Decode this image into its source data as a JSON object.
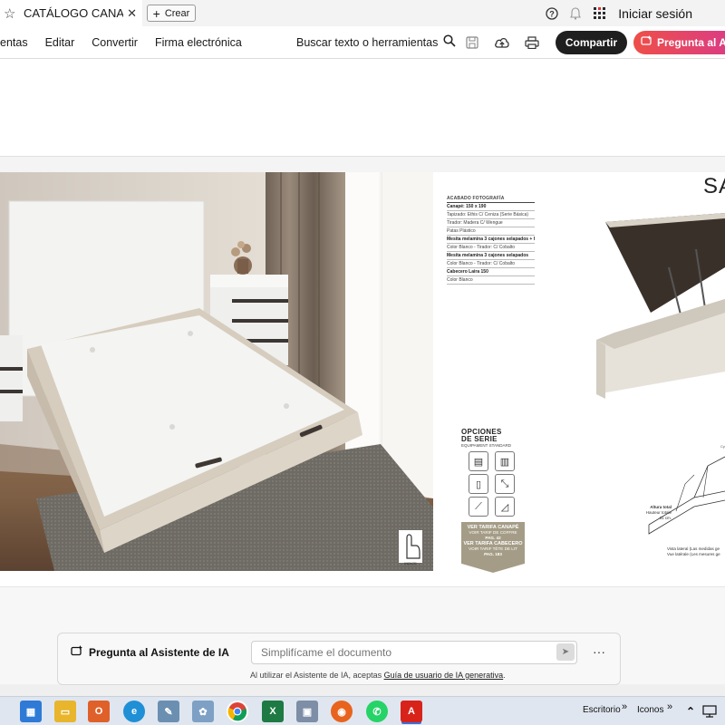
{
  "tab": {
    "title": "CATÁLOGO CANAP...",
    "close": "✕",
    "new_tab_label": "Crear"
  },
  "titlebar": {
    "signin": "Iniciar sesión"
  },
  "toolbar": {
    "menus": [
      "entas",
      "Editar",
      "Convertir",
      "Firma electrónica"
    ],
    "search_label": "Buscar texto o herramientas",
    "share": "Compartir",
    "ai_button": "Pregunta al A"
  },
  "document": {
    "model_title": "SA",
    "specs": {
      "heading": "ACABADO FOTOGRAFÍA",
      "lines": [
        {
          "text": "Canapé: 150 x 190",
          "bold": true
        },
        {
          "text": "Tapizado: Ethis C/ Ceniza (Serie Básica)",
          "bold": false
        },
        {
          "text": "Tirador: Madera C/ Wengue",
          "bold": false
        },
        {
          "text": "Patas Plástico",
          "bold": false
        },
        {
          "text": "Mesita melamina 3 cajones selapados + hueco",
          "bold": true
        },
        {
          "text": "Color Blanco - Tirador: C/ Cobalto",
          "bold": false
        },
        {
          "text": "Mesita melamina 3 cajones selapados",
          "bold": true
        },
        {
          "text": "Color Blanco - Tirador: C/ Cobalto",
          "bold": false
        },
        {
          "text": "Cabecero Laira 150",
          "bold": true
        },
        {
          "text": "Color Blanco",
          "bold": false
        }
      ]
    },
    "opciones": {
      "title_line1": "OPCIONES",
      "title_line2": "DE SERIE",
      "subtitle": "EQUIPAMENT STANDARD"
    },
    "tarifa": {
      "canape_head": "VER TARIFA CANAPÉ",
      "canape_sub": "VOIR TARIF DE COFFRE",
      "canape_page": "PAG. 42",
      "cabecero_head": "VER TARIFA CABECERO",
      "cabecero_sub": "VOIR TARIF TÊTE DE LIT",
      "cabecero_page": "PAG. 183"
    },
    "indice_label": "INDICE",
    "caption_alt": [
      "Altura total",
      "Hauteur totale",
      "31 cm."
    ],
    "caption_bottom": [
      "Vista lateral (Las medidas ge",
      "Vue latérale (Les mesures ge"
    ],
    "caption_mid": "Cy"
  },
  "ai_bar": {
    "label": "Pregunta al Asistente de IA",
    "placeholder": "Simplifícame el documento",
    "more": "···",
    "disclaimer_prefix": "Al utilizar el Asistente de IA, aceptas ",
    "disclaimer_link": "Guía de usuario de IA generativa",
    "disclaimer_suffix": "."
  },
  "taskbar": {
    "escritorio": "Escritorio",
    "iconos": "Iconos",
    "chevron": "»"
  }
}
